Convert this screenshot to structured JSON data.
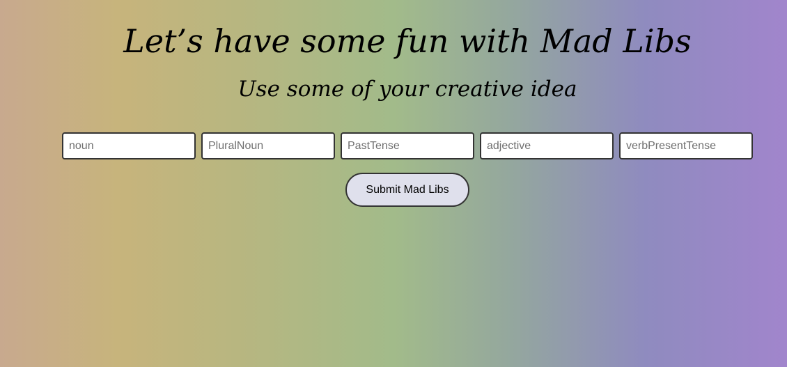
{
  "header": {
    "title": "Let’s have some fun with Mad Libs",
    "subtitle": "Use some of your creative idea"
  },
  "form": {
    "fields": [
      {
        "name": "noun",
        "value": "",
        "placeholder": "noun"
      },
      {
        "name": "PluralNoun",
        "value": "",
        "placeholder": "PluralNoun"
      },
      {
        "name": "PastTense",
        "value": "",
        "placeholder": "PastTense"
      },
      {
        "name": "adjective",
        "value": "",
        "placeholder": "adjective"
      },
      {
        "name": "verbPresentTense",
        "value": "",
        "placeholder": "verbPresentTense"
      }
    ],
    "submit_label": "Submit Mad Libs"
  }
}
